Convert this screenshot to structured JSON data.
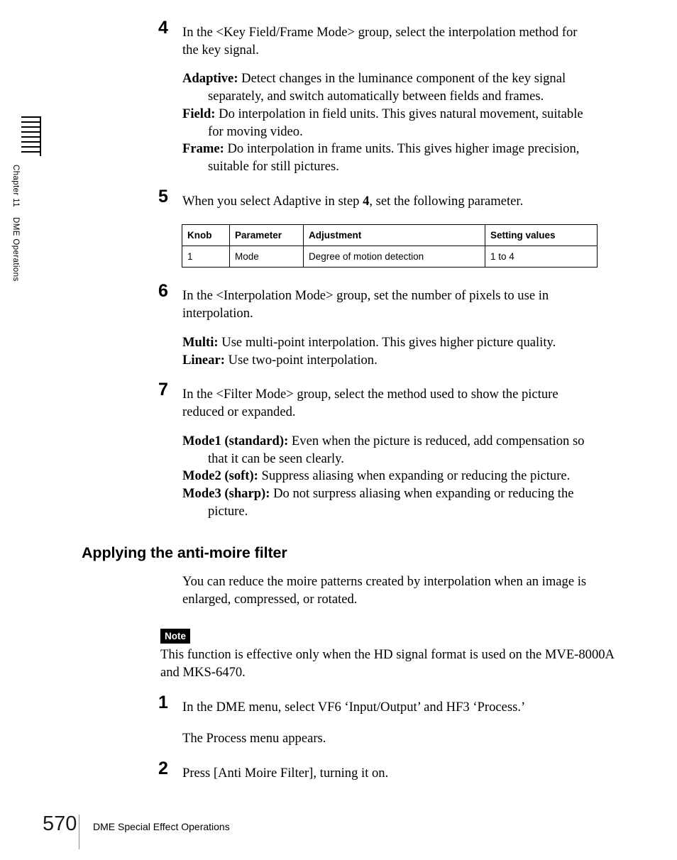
{
  "margin": {
    "chapter_label_part1": "Chapter 11",
    "chapter_label_part2": "DME Operations"
  },
  "steps": [
    {
      "number": "4",
      "text": "In the <Key Field/Frame Mode> group, select the interpolation method for the key signal.",
      "definitions": [
        {
          "term": "Adaptive:",
          "desc": "Detect changes in the luminance component of the key signal separately, and switch automatically between fields and frames."
        },
        {
          "term": "Field:",
          "desc": "Do interpolation in field units. This gives natural movement, suitable for moving video."
        },
        {
          "term": "Frame:",
          "desc": "Do interpolation in frame units. This gives higher image precision, suitable for still pictures."
        }
      ]
    },
    {
      "number": "5",
      "text_pre": "When you select Adaptive in step ",
      "text_bold": "4",
      "text_post": ", set the following parameter."
    },
    {
      "number": "6",
      "text": "In the <Interpolation Mode> group, set the number of pixels to use in interpolation.",
      "definitions": [
        {
          "term": "Multi:",
          "desc": "Use multi-point interpolation.  This gives higher picture quality."
        },
        {
          "term": "Linear:",
          "desc": "Use two-point interpolation."
        }
      ]
    },
    {
      "number": "7",
      "text": "In the <Filter Mode> group, select the method used to show the picture reduced or expanded.",
      "definitions": [
        {
          "term": "Mode1 (standard):",
          "desc": "Even when the picture is reduced, add compensation so that it can be seen clearly."
        },
        {
          "term": "Mode2 (soft):",
          "desc": "Suppress aliasing when expanding or reducing the picture."
        },
        {
          "term": "Mode3 (sharp):",
          "desc": "Do not surpress aliasing when expanding or reducing the picture."
        }
      ]
    }
  ],
  "param_table": {
    "headers": [
      "Knob",
      "Parameter",
      "Adjustment",
      "Setting values"
    ],
    "rows": [
      [
        "1",
        "Mode",
        "Degree of motion detection",
        "1 to 4"
      ]
    ]
  },
  "section": {
    "heading": "Applying the anti-moire filter",
    "intro": "You can reduce the moire patterns created by interpolation when an image is enlarged, compressed, or rotated."
  },
  "note": {
    "badge": "Note",
    "text": "This function is effective only when the HD signal format is used on the MVE-8000A and MKS-6470."
  },
  "procedure": [
    {
      "number": "1",
      "text": "In the DME menu, select VF6 ‘Input/Output’ and HF3 ‘Process.’",
      "result": "The Process menu appears."
    },
    {
      "number": "2",
      "text": "Press [Anti Moire Filter], turning it on."
    }
  ],
  "footer": {
    "page_number": "570",
    "running_title": "DME Special Effect Operations"
  }
}
